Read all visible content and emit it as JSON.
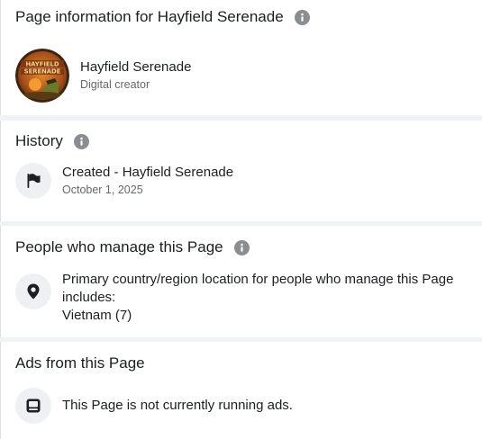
{
  "page_info": {
    "title": "Page information for Hayfield Serenade",
    "info_icon": "info-circle-icon",
    "avatar_text": "HAYFIELD SERENADE",
    "name": "Hayfield Serenade",
    "category": "Digital creator"
  },
  "history": {
    "title": "History",
    "info_icon": "info-circle-icon",
    "item_icon": "flag-icon",
    "event": "Created - Hayfield Serenade",
    "date": "October 1, 2025"
  },
  "people": {
    "title": "People who manage this Page",
    "info_icon": "info-circle-icon",
    "item_icon": "location-pin-icon",
    "description": "Primary country/region location for people who manage this Page includes:",
    "country": "Vietnam (7)"
  },
  "ads": {
    "title": "Ads from this Page",
    "item_icon": "ad-screen-icon",
    "status": "This Page is not currently running ads."
  },
  "colors": {
    "background": "#f0f2f5",
    "card": "#ffffff",
    "primary_text": "#1c1e21",
    "secondary_text": "#65676b",
    "icon_gray": "#8a8d91",
    "icon_circle": "#eef0f3"
  }
}
